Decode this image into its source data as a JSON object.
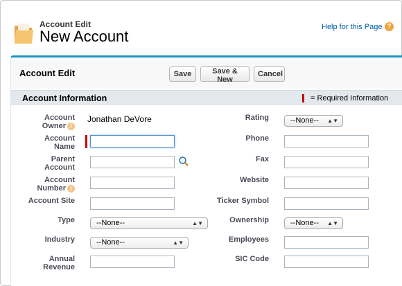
{
  "header": {
    "subtitle": "Account Edit",
    "title": "New Account",
    "help_link": "Help for this Page",
    "help_icon": "?"
  },
  "panel": {
    "title": "Account Edit",
    "buttons": {
      "save": "Save",
      "save_new": "Save & New",
      "cancel": "Cancel"
    }
  },
  "section": {
    "title": "Account Information",
    "required_legend": "= Required Information"
  },
  "fields": {
    "account_owner": {
      "label_line1": "Account",
      "label_line2": "Owner",
      "value": "Jonathan DeVore"
    },
    "account_name": {
      "label_line1": "Account",
      "label_line2": "Name",
      "value": ""
    },
    "parent_account": {
      "label_line1": "Parent",
      "label_line2": "Account",
      "value": ""
    },
    "account_number": {
      "label_line1": "Account",
      "label_line2": "Number",
      "value": ""
    },
    "account_site": {
      "label": "Account Site",
      "value": ""
    },
    "type": {
      "label": "Type",
      "value": "--None--"
    },
    "industry": {
      "label": "Industry",
      "value": "--None--"
    },
    "annual_revenue": {
      "label_line1": "Annual",
      "label_line2": "Revenue",
      "value": ""
    },
    "rating": {
      "label": "Rating",
      "value": "--None--"
    },
    "phone": {
      "label": "Phone",
      "value": ""
    },
    "fax": {
      "label": "Fax",
      "value": ""
    },
    "website": {
      "label": "Website",
      "value": ""
    },
    "ticker_symbol": {
      "label": "Ticker Symbol",
      "value": ""
    },
    "ownership": {
      "label": "Ownership",
      "value": "--None--"
    },
    "employees": {
      "label": "Employees",
      "value": ""
    },
    "sic_code": {
      "label": "SIC Code",
      "value": ""
    }
  },
  "colors": {
    "accent": "#1797c0",
    "required": "#cc0000",
    "link": "#015ba7",
    "section_bg": "#e3e8ed"
  },
  "icons": {
    "header": "folder-icon",
    "help": "help-icon",
    "lookup": "lookup-magnifier-icon",
    "info": "info-icon",
    "select_arrow": "updown-arrow-icon"
  }
}
